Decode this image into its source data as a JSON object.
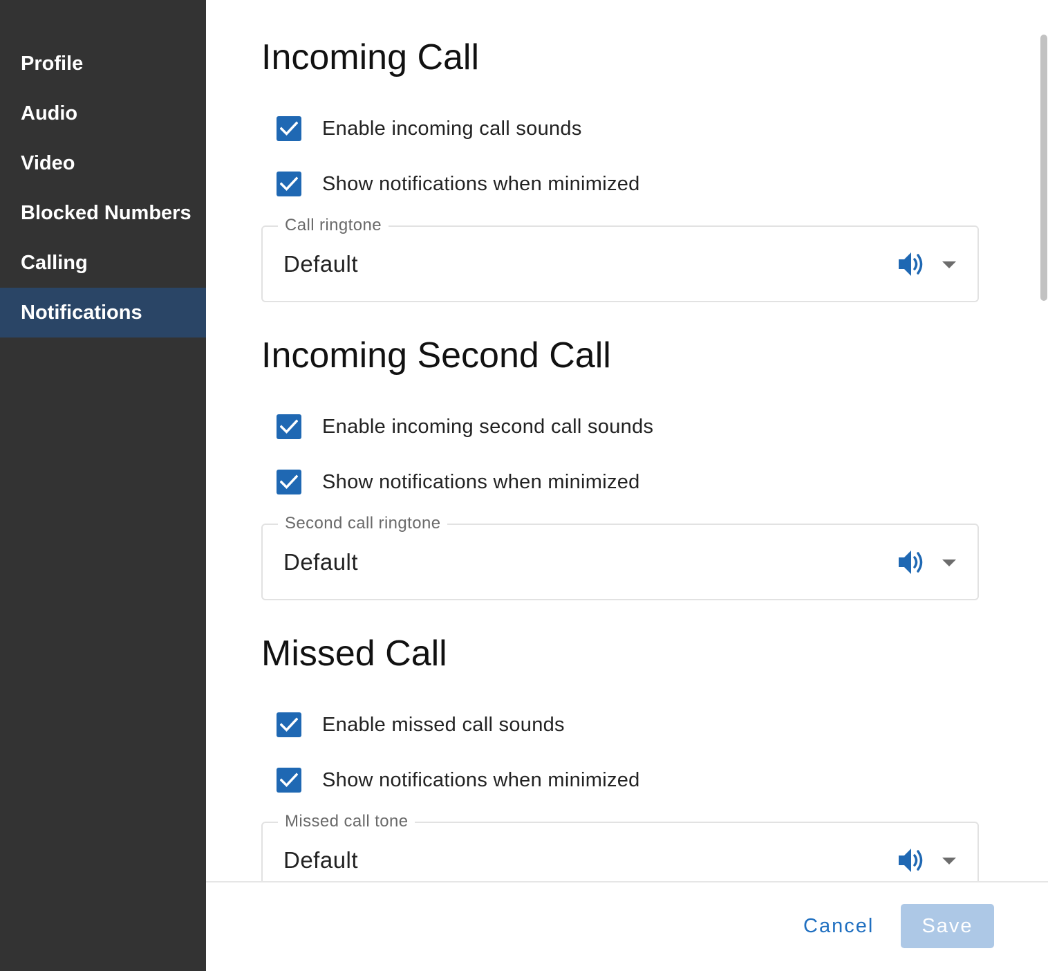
{
  "sidebar": {
    "items": [
      {
        "label": "Profile"
      },
      {
        "label": "Audio"
      },
      {
        "label": "Video"
      },
      {
        "label": "Blocked Numbers"
      },
      {
        "label": "Calling"
      },
      {
        "label": "Notifications",
        "active": true
      }
    ]
  },
  "sections": [
    {
      "title": "Incoming Call",
      "options": [
        {
          "label": "Enable incoming call sounds",
          "checked": true
        },
        {
          "label": "Show notifications when minimized",
          "checked": true
        }
      ],
      "select": {
        "label": "Call ringtone",
        "value": "Default",
        "icon": "speaker-icon"
      }
    },
    {
      "title": "Incoming Second Call",
      "options": [
        {
          "label": "Enable incoming second call sounds",
          "checked": true
        },
        {
          "label": "Show notifications when minimized",
          "checked": true
        }
      ],
      "select": {
        "label": "Second call ringtone",
        "value": "Default",
        "icon": "speaker-icon"
      }
    },
    {
      "title": "Missed Call",
      "options": [
        {
          "label": "Enable missed call sounds",
          "checked": true
        },
        {
          "label": "Show notifications when minimized",
          "checked": true
        }
      ],
      "select": {
        "label": "Missed call tone",
        "value": "Default",
        "icon": "speaker-icon"
      }
    }
  ],
  "footer": {
    "cancel_label": "Cancel",
    "save_label": "Save",
    "save_enabled": false
  },
  "colors": {
    "sidebar_bg": "#333333",
    "sidebar_active_bg": "#2a4566",
    "accent": "#1f68b3",
    "save_disabled_bg": "#adc8e6"
  }
}
